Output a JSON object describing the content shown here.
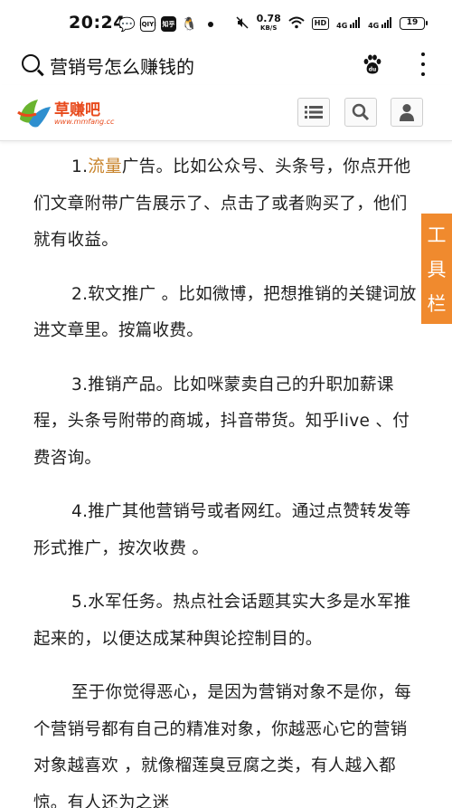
{
  "status_bar": {
    "time": "20:24",
    "speed_value": "0.78",
    "speed_unit": "KB/S",
    "hd_label": "HD",
    "signal1": "4G",
    "signal2": "4G",
    "battery": "19",
    "app_icons": [
      "wechat-icon",
      "iqiyi-icon",
      "zhihu-icon",
      "qq-icon"
    ],
    "iqiyi_label": "iQIYI",
    "zhihu_label": "知乎"
  },
  "search": {
    "query": "营销号怎么赚钱的"
  },
  "site": {
    "logo_text": "草赚吧",
    "logo_url": "www.mmfang.cc",
    "toolbar_chars": [
      "工",
      "具",
      "栏"
    ]
  },
  "article": {
    "p1_num": "1.",
    "p1_highlight": "流量",
    "p1_rest": "广告。比如公众号、头条号，你点开他们文章附带广告展示了、点击了或者购买了，他们就有收益。",
    "p2": "2.软文推广 。比如微博，把想推销的关键词放进文章里。按篇收费。",
    "p3": "3.推销产品。比如咪蒙卖自己的升职加薪课程，头条号附带的商城，抖音带货。知乎live 、付费咨询。",
    "p4": "4.推广其他营销号或者网红。通过点赞转发等形式推广，按次收费 。",
    "p5": "5.水军任务。热点社会话题其实大多是水军推起来的，以便达成某种舆论控制目的。",
    "p6": "至于你觉得恶心，是因为营销对象不是你，每个营销号都有自己的精准对象，你越恶心它的营销对象越喜欢 ，就像榴莲臭豆腐之类，有人越入都惊。有人还为之迷"
  },
  "colors": {
    "accent_orange": "#f08a2e",
    "highlight": "#c8842c",
    "logo": "#e84a1c"
  }
}
